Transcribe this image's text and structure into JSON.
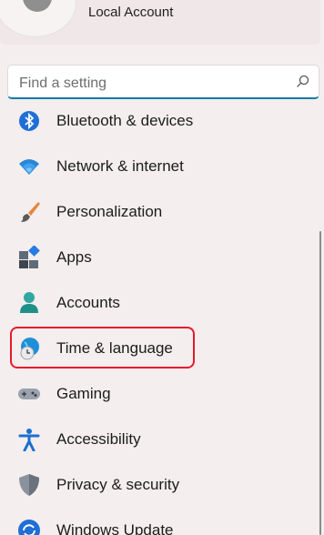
{
  "account": {
    "label": "Local Account"
  },
  "search": {
    "placeholder": "Find a setting"
  },
  "nav": {
    "items": [
      {
        "label": "Bluetooth & devices",
        "icon": "bluetooth-icon"
      },
      {
        "label": "Network & internet",
        "icon": "wifi-icon"
      },
      {
        "label": "Personalization",
        "icon": "paintbrush-icon"
      },
      {
        "label": "Apps",
        "icon": "apps-icon"
      },
      {
        "label": "Accounts",
        "icon": "person-icon"
      },
      {
        "label": "Time & language",
        "icon": "globe-clock-icon"
      },
      {
        "label": "Gaming",
        "icon": "gamepad-icon"
      },
      {
        "label": "Accessibility",
        "icon": "accessibility-icon"
      },
      {
        "label": "Privacy & security",
        "icon": "shield-icon"
      },
      {
        "label": "Windows Update",
        "icon": "update-icon"
      }
    ],
    "highlighted": "Time & language"
  },
  "colors": {
    "accent": "#0b7ba8",
    "highlight_border": "#e8192c",
    "background": "#f4eeee"
  }
}
